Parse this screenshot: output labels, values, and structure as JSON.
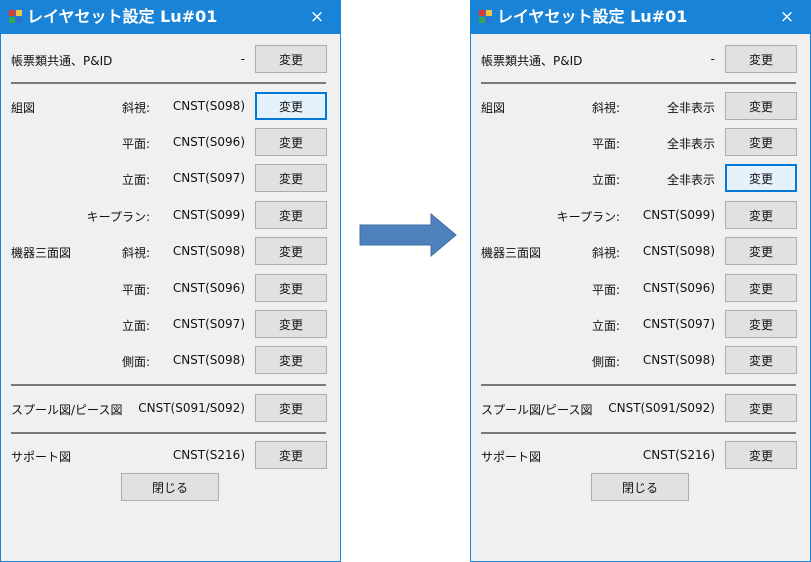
{
  "colors": {
    "titlebar": "#1883d7",
    "focus": "#0078d7",
    "arrow": "#4f81bd"
  },
  "left": {
    "title": "レイヤセット設定 Lu#01",
    "close_glyph": "×",
    "common": {
      "label": "帳票類共通、P&ID",
      "value": "-",
      "button": "変更"
    },
    "kumizu": {
      "label": "組図",
      "rows": [
        {
          "sub": "斜視:",
          "value": "CNST(S098)",
          "button": "変更"
        },
        {
          "sub": "平面:",
          "value": "CNST(S096)",
          "button": "変更"
        },
        {
          "sub": "立面:",
          "value": "CNST(S097)",
          "button": "変更"
        },
        {
          "sub": "キープラン:",
          "value": "CNST(S099)",
          "button": "変更"
        }
      ]
    },
    "kiki": {
      "label": "機器三面図",
      "rows": [
        {
          "sub": "斜視:",
          "value": "CNST(S098)",
          "button": "変更"
        },
        {
          "sub": "平面:",
          "value": "CNST(S096)",
          "button": "変更"
        },
        {
          "sub": "立面:",
          "value": "CNST(S097)",
          "button": "変更"
        },
        {
          "sub": "側面:",
          "value": "CNST(S098)",
          "button": "変更"
        }
      ]
    },
    "spool": {
      "label": "スプール図/ピース図",
      "value": "CNST(S091/S092)",
      "button": "変更"
    },
    "support": {
      "label": "サポート図",
      "value": "CNST(S216)",
      "button": "変更"
    },
    "close_button": "閉じる"
  },
  "right": {
    "title": "レイヤセット設定 Lu#01",
    "close_glyph": "×",
    "common": {
      "label": "帳票類共通、P&ID",
      "value": "-",
      "button": "変更"
    },
    "kumizu": {
      "label": "組図",
      "rows": [
        {
          "sub": "斜視:",
          "value": "全非表示",
          "button": "変更"
        },
        {
          "sub": "平面:",
          "value": "全非表示",
          "button": "変更"
        },
        {
          "sub": "立面:",
          "value": "全非表示",
          "button": "変更"
        },
        {
          "sub": "キープラン:",
          "value": "CNST(S099)",
          "button": "変更"
        }
      ]
    },
    "kiki": {
      "label": "機器三面図",
      "rows": [
        {
          "sub": "斜視:",
          "value": "CNST(S098)",
          "button": "変更"
        },
        {
          "sub": "平面:",
          "value": "CNST(S096)",
          "button": "変更"
        },
        {
          "sub": "立面:",
          "value": "CNST(S097)",
          "button": "変更"
        },
        {
          "sub": "側面:",
          "value": "CNST(S098)",
          "button": "変更"
        }
      ]
    },
    "spool": {
      "label": "スプール図/ピース図",
      "value": "CNST(S091/S092)",
      "button": "変更"
    },
    "support": {
      "label": "サポート図",
      "value": "CNST(S216)",
      "button": "変更"
    },
    "close_button": "閉じる"
  }
}
